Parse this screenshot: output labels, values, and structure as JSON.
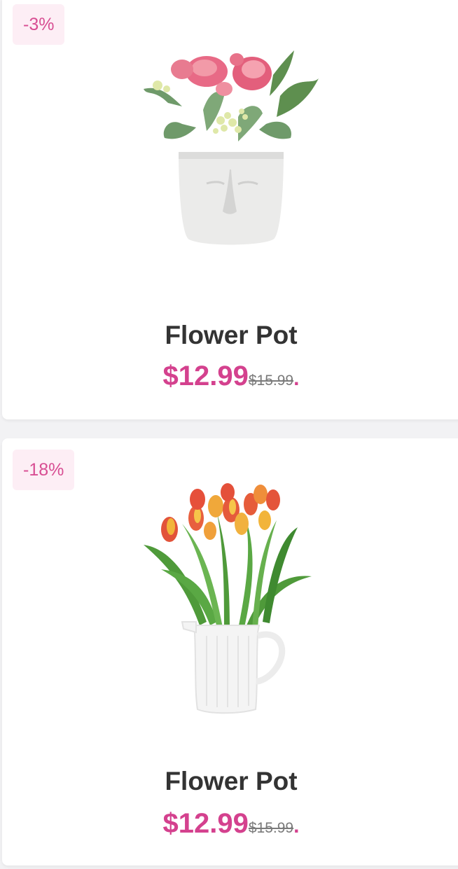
{
  "products": [
    {
      "discount": "-3%",
      "image_alt": "pink peonies in white face pot",
      "name": "Flower Pot",
      "price": "$12.99",
      "old_price": "$15.99",
      "suffix": "."
    },
    {
      "discount": "-18%",
      "image_alt": "tulips in white pitcher vase",
      "name": "Flower Pot",
      "price": "$12.99",
      "old_price": "$15.99",
      "suffix": "."
    }
  ],
  "colors": {
    "accent": "#d4418e",
    "badge_bg": "#fdeef5",
    "title": "#333333",
    "old_price": "#7a7a7a"
  }
}
